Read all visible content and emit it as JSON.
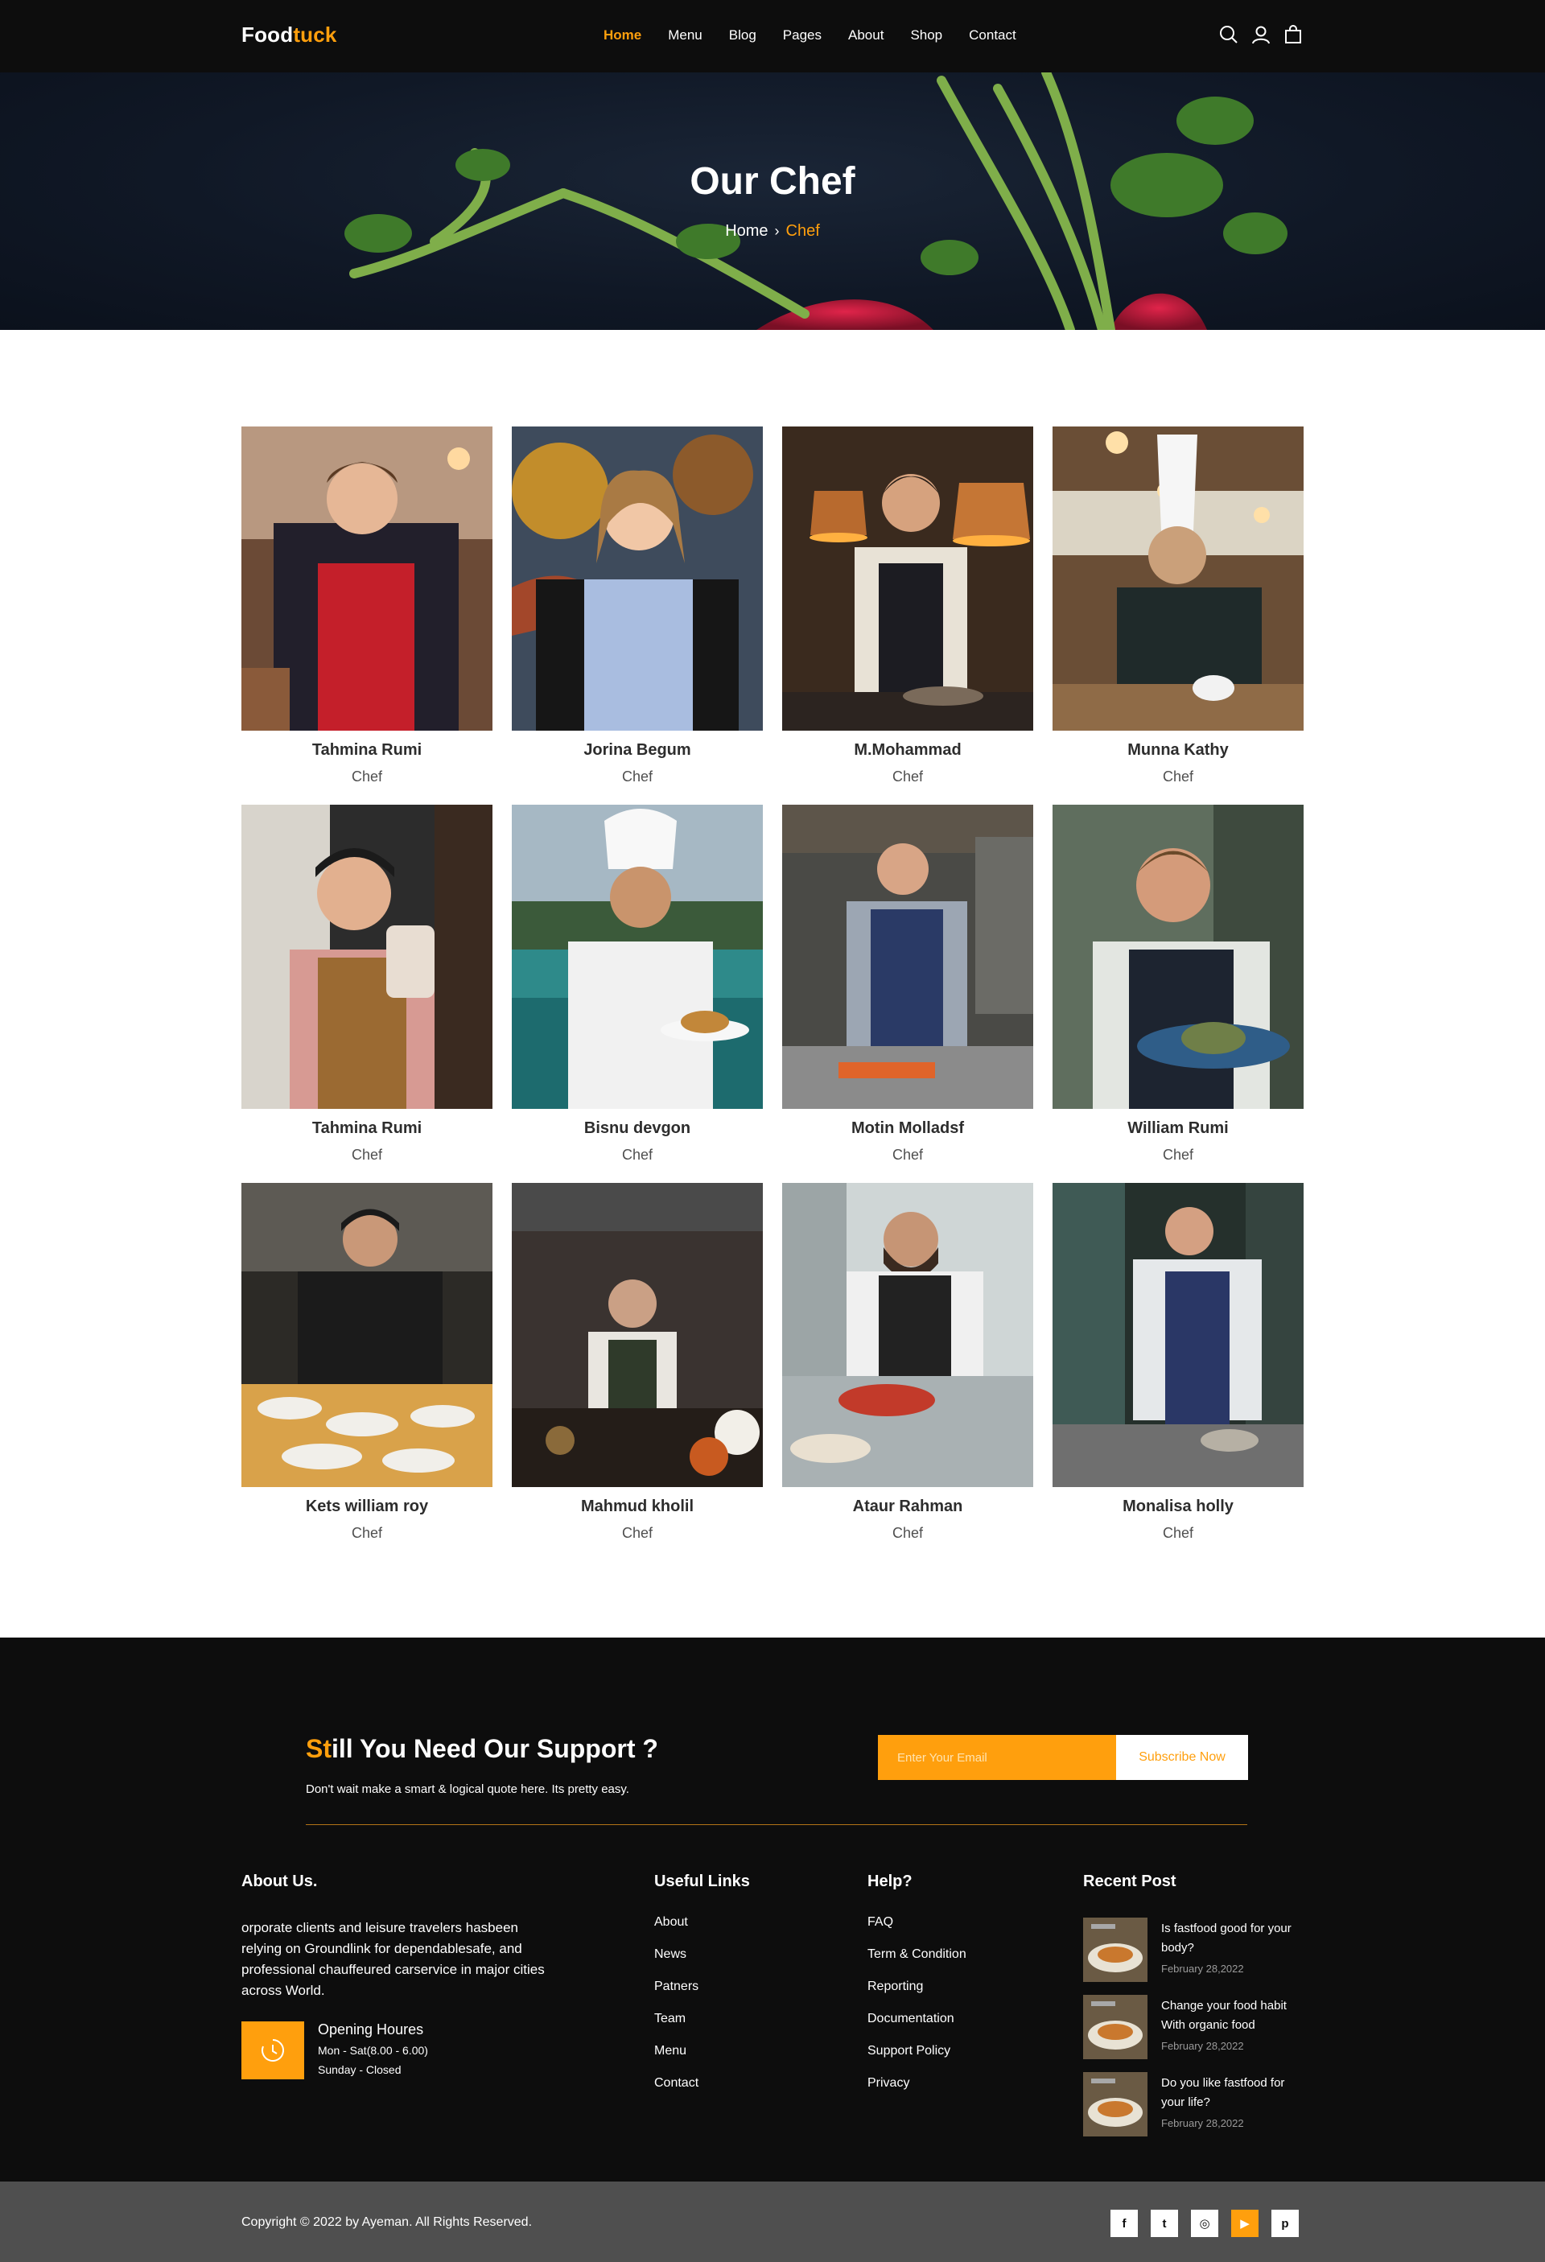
{
  "brand": {
    "name_part1": "Food",
    "name_part2": "tuck",
    "accent_color": "#ff9f0d"
  },
  "nav": {
    "items": [
      {
        "label": "Home",
        "active": true
      },
      {
        "label": "Menu"
      },
      {
        "label": "Blog"
      },
      {
        "label": "Pages"
      },
      {
        "label": "About"
      },
      {
        "label": "Shop"
      },
      {
        "label": "Contact"
      }
    ],
    "icons": [
      "search-icon",
      "user-icon",
      "shopping-bag-icon"
    ]
  },
  "hero": {
    "title": "Our Chef",
    "breadcrumb": {
      "home": "Home",
      "separator": "›",
      "current": "Chef"
    }
  },
  "chefs": [
    {
      "name": "Tahmina Rumi",
      "role": "Chef"
    },
    {
      "name": "Jorina Begum",
      "role": "Chef"
    },
    {
      "name": "M.Mohammad",
      "role": "Chef"
    },
    {
      "name": "Munna Kathy",
      "role": "Chef"
    },
    {
      "name": "Tahmina Rumi",
      "role": "Chef"
    },
    {
      "name": "Bisnu devgon",
      "role": "Chef"
    },
    {
      "name": "Motin Molladsf",
      "role": "Chef"
    },
    {
      "name": "William Rumi",
      "role": "Chef"
    },
    {
      "name": "Kets william roy",
      "role": "Chef"
    },
    {
      "name": "Mahmud kholil",
      "role": "Chef"
    },
    {
      "name": "Ataur Rahman",
      "role": "Chef"
    },
    {
      "name": "Monalisa holly",
      "role": "Chef"
    }
  ],
  "support": {
    "title_highlight": "St",
    "title_rest": "ill You Need Our Support ?",
    "subtitle": "Don't wait make a smart & logical quote here. Its pretty easy.",
    "email_placeholder": "Enter Your Email",
    "button_label": "Subscribe Now"
  },
  "footer": {
    "about": {
      "title": "About Us.",
      "text": "orporate clients and leisure travelers hasbeen relying on Groundlink for dependablesafe, and professional chauffeured carservice in major cities across World.",
      "hours_title": "Opening Houres",
      "hours_line1": "Mon - Sat(8.00 - 6.00)",
      "hours_line2": "Sunday - Closed"
    },
    "useful_links": {
      "title": "Useful Links",
      "items": [
        "About",
        "News",
        "Patners",
        "Team",
        "Menu",
        "Contact"
      ]
    },
    "help": {
      "title": "Help?",
      "items": [
        "FAQ",
        "Term & Condition",
        "Reporting",
        "Documentation",
        "Support Policy",
        "Privacy"
      ]
    },
    "recent": {
      "title": "Recent Post",
      "posts": [
        {
          "title": "Is fastfood good for your body?",
          "date": "February 28,2022"
        },
        {
          "title": "Change your food habit With organic food",
          "date": "February 28,2022"
        },
        {
          "title": "Do you like fastfood for your life?",
          "date": "February 28,2022"
        }
      ]
    },
    "copyright": "Copyright © 2022 by Ayeman. All Rights Reserved.",
    "socials": [
      {
        "icon": "facebook-icon",
        "glyph": "f"
      },
      {
        "icon": "twitter-icon",
        "glyph": "t"
      },
      {
        "icon": "instagram-icon",
        "glyph": "◎"
      },
      {
        "icon": "youtube-icon",
        "glyph": "▶"
      },
      {
        "icon": "pinterest-icon",
        "glyph": "p"
      }
    ]
  }
}
